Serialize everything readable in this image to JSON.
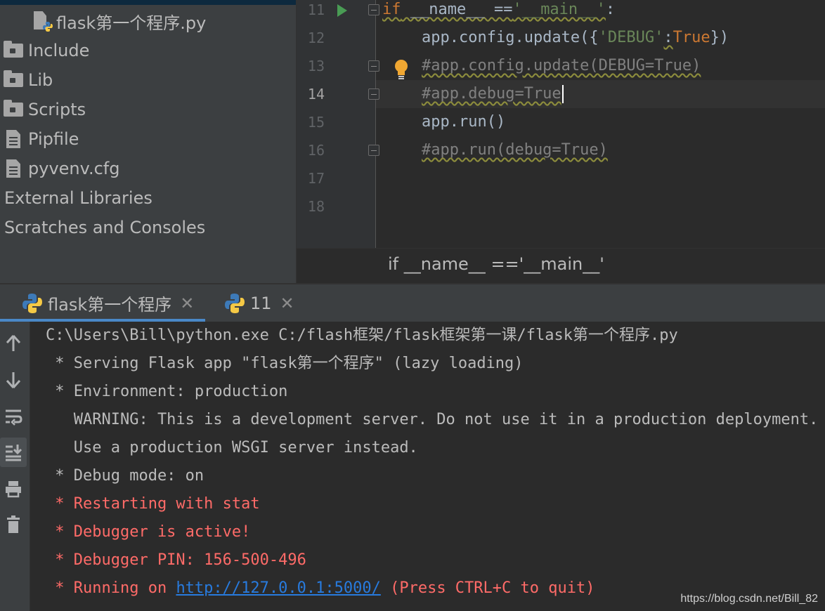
{
  "project_tree": {
    "items": [
      {
        "label": "flask第一个程序.py",
        "icon": "python-file-icon"
      },
      {
        "label": "Include",
        "icon": "folder-icon"
      },
      {
        "label": "Lib",
        "icon": "folder-icon"
      },
      {
        "label": "Scripts",
        "icon": "folder-icon"
      },
      {
        "label": "Pipfile",
        "icon": "file-icon"
      },
      {
        "label": "pyvenv.cfg",
        "icon": "file-icon"
      },
      {
        "label": "External Libraries",
        "icon": ""
      },
      {
        "label": "Scratches and Consoles",
        "icon": ""
      }
    ]
  },
  "editor": {
    "line_numbers": [
      "11",
      "12",
      "13",
      "14",
      "15",
      "16",
      "17",
      "18"
    ],
    "active_line": "14",
    "lines": {
      "l11": {
        "kw_if": "if",
        "name": " __name__ ==",
        "str_main": "'__main__'",
        "colon": ":"
      },
      "l12": {
        "prefix": "app.config.update({",
        "str_debug": "'DEBUG'",
        "colon": ":",
        "kw_true": "True",
        "suffix": "})"
      },
      "l13": {
        "comment": "#app.config.update(DEBUG=True)"
      },
      "l14": {
        "comment": "#app.debug=True"
      },
      "l15": {
        "code": "app.run()"
      },
      "l16": {
        "comment": "#app.run(debug=True)"
      }
    },
    "breadcrumb": "if __name__ =='__main__'"
  },
  "run_tabs": [
    {
      "label": "flask第一个程序",
      "active": true
    },
    {
      "label": "11",
      "active": false
    }
  ],
  "console": {
    "lines": [
      {
        "text": "C:\\Users\\Bill\\python.exe C:/flash框架/flask框架第一课/flask第一个程序.py",
        "type": "normal"
      },
      {
        "text": " * Serving Flask app \"flask第一个程序\" (lazy loading)",
        "type": "normal"
      },
      {
        "text": " * Environment: production",
        "type": "normal"
      },
      {
        "text": "   WARNING: This is a development server. Do not use it in a production deployment.",
        "type": "normal"
      },
      {
        "text": "   Use a production WSGI server instead.",
        "type": "normal"
      },
      {
        "text": " * Debug mode: on",
        "type": "normal"
      },
      {
        "text": " * Restarting with stat",
        "type": "error"
      },
      {
        "text": " * Debugger is active!",
        "type": "error"
      },
      {
        "text": " * Debugger PIN: 156-500-496",
        "type": "error"
      }
    ],
    "last_line": {
      "prefix": " * Running on ",
      "link": "http://127.0.0.1:5000/",
      "suffix": " (Press CTRL+C to quit)"
    },
    "toolbar": [
      "up-arrow-icon",
      "down-arrow-icon",
      "soft-wrap-icon",
      "scroll-to-end-icon",
      "print-icon",
      "trash-icon"
    ]
  },
  "watermark": "https://blog.csdn.net/Bill_82",
  "colors": {
    "keyword": "#cc7832",
    "string": "#6a8759",
    "comment": "#808080",
    "error_text": "#ff6b68",
    "link": "#287bde",
    "run_green": "#499c54",
    "tab_underline": "#4a88c7"
  }
}
